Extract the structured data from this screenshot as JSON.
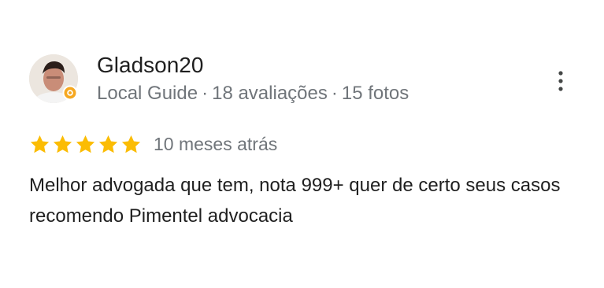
{
  "review": {
    "author_name": "Gladson20",
    "author_role": "Local Guide",
    "separator": "·",
    "reviews_count": "18 avaliações",
    "photos_count": "15 fotos",
    "rating": 5,
    "rating_max": 5,
    "date": "10 meses atrás",
    "text": "Melhor advogada que tem, nota 999+ quer de certo seus casos recomendo Pimentel advocacia"
  },
  "icons": {
    "star": "star-icon",
    "more": "more-vert-icon",
    "badge": "local-guide-badge-icon"
  },
  "colors": {
    "star": "#fbbc04",
    "name": "#1f1f1f",
    "meta": "#70757a",
    "badge": "#f5a623"
  }
}
